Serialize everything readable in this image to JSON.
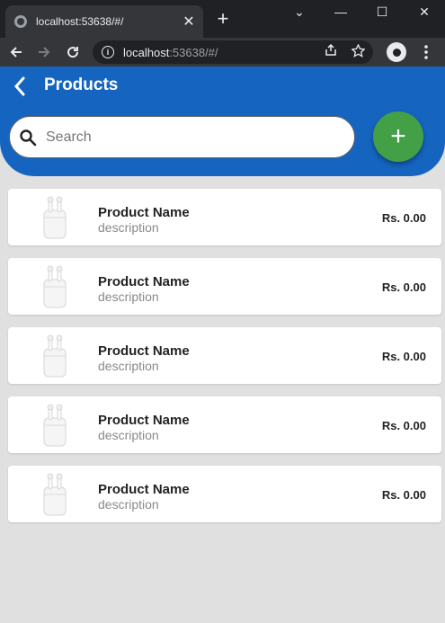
{
  "browser": {
    "tab_title": "localhost:53638/#/",
    "tab_close": "✕",
    "new_tab": "+",
    "url_host": "localhost",
    "url_rest": ":53638/#/",
    "window_controls": {
      "minimize": "—",
      "maximize": "☐",
      "close": "✕",
      "tabs_menu": "⌄"
    }
  },
  "app": {
    "title": "Products",
    "search": {
      "placeholder": "Search",
      "value": ""
    },
    "add_button": "+",
    "colors": {
      "appbar": "#1565c0",
      "fab": "#43a047"
    }
  },
  "products": [
    {
      "name": "Product Name",
      "description": "description",
      "price": "Rs. 0.00"
    },
    {
      "name": "Product Name",
      "description": "description",
      "price": "Rs. 0.00"
    },
    {
      "name": "Product Name",
      "description": "description",
      "price": "Rs. 0.00"
    },
    {
      "name": "Product Name",
      "description": "description",
      "price": "Rs. 0.00"
    },
    {
      "name": "Product Name",
      "description": "description",
      "price": "Rs. 0.00"
    }
  ]
}
